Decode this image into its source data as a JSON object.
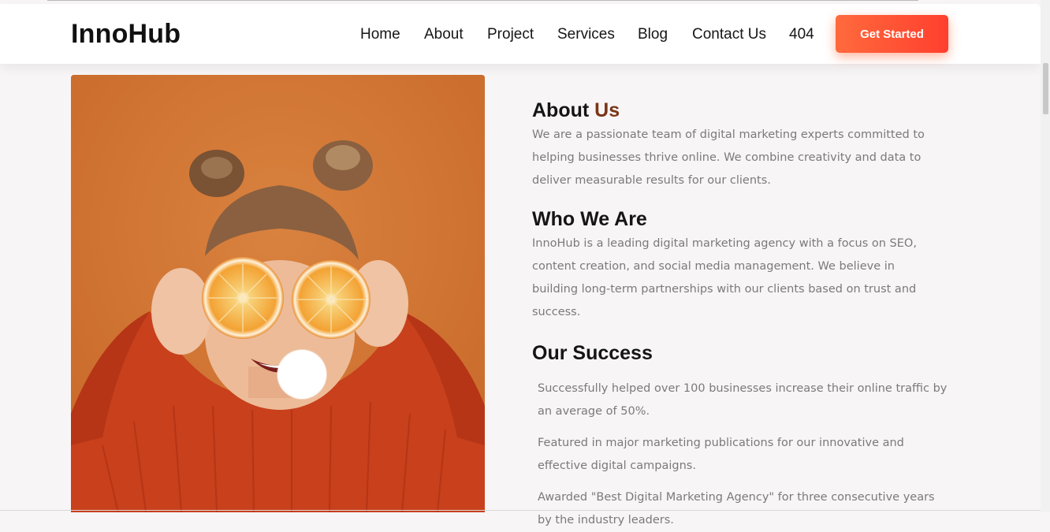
{
  "brand": {
    "name": "InnoHub",
    "accent_color": "#ff5a36"
  },
  "nav": {
    "items": [
      "Home",
      "About",
      "Project",
      "Services",
      "Blog",
      "Contact Us",
      "404"
    ],
    "cta_label": "Get Started"
  },
  "hero_image": {
    "subject": "woman-holding-orange-halves-image"
  },
  "about": {
    "title_part1": "About ",
    "title_part2": "Us",
    "text": "We are a passionate team of digital marketing experts committed to helping businesses thrive online. We combine creativity and data to deliver measurable results for our clients."
  },
  "who": {
    "title": "Who We Are",
    "text": "InnoHub is a leading digital marketing agency with a focus on SEO, content creation, and social media management. We believe in building long-term partnerships with our clients based on trust and success."
  },
  "success": {
    "title": "Our Success",
    "items": [
      "Successfully helped over 100 businesses increase their online traffic by an average of 50%.",
      "Featured in major marketing publications for our innovative and effective digital campaigns.",
      "Awarded \"Best Digital Marketing Agency\" for three consecutive years by the industry leaders."
    ]
  }
}
